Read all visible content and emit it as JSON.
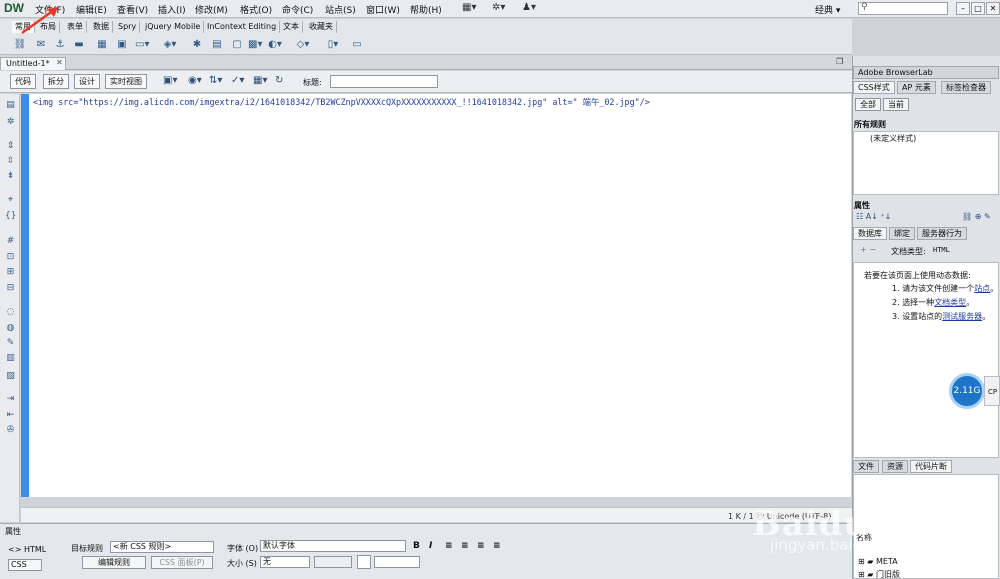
{
  "app": {
    "logo": "DW",
    "menu": [
      "文件(F)",
      "编辑(E)",
      "查看(V)",
      "插入(I)",
      "修改(M)",
      "格式(O)",
      "命令(C)",
      "站点(S)",
      "窗口(W)",
      "帮助(H)"
    ],
    "workspace": "经典",
    "search_placeholder": ""
  },
  "insert_tabs": [
    "常用",
    "布局",
    "表单",
    "数据",
    "Spry",
    "jQuery Mobile",
    "InContext Editing",
    "文本",
    "收藏夹"
  ],
  "document": {
    "tab_label": "Untitled-1*",
    "views": [
      "代码",
      "拆分",
      "设计",
      "实时视图"
    ],
    "title_label": "标题:",
    "title_value": "",
    "code": "<img src=\"https://img.alicdn.com/imgextra/i2/1641018342/TB2WCZnpVXXXXcQXpXXXXXXXXXXX_!!1641018342.jpg\" alt=\" 端午_02.jpg\"/>",
    "status": "1 K / 1 秒  Unicode (UTF-8)"
  },
  "properties": {
    "title": "属性",
    "html_btn": "<> HTML",
    "css_btn": "CSS",
    "target_rule_label": "目标规则",
    "target_rule_value": "<新 CSS 规则>",
    "edit_rule_btn": "编辑规则",
    "css_panel_btn": "CSS 面板(P)",
    "font_label": "字体 (O)",
    "font_value": "默认字体",
    "size_label": "大小 (S)",
    "size_value": "无"
  },
  "right_panel": {
    "browserlab": "Adobe BrowserLab",
    "css_tabs": [
      "CSS样式",
      "AP 元素",
      "标签检查器"
    ],
    "css_buttons": [
      "全部",
      "当前"
    ],
    "all_rules": "所有规则",
    "undefined_style": "(未定义样式)",
    "props_title": "属性",
    "db_tabs": [
      "数据库",
      "绑定",
      "服务器行为"
    ],
    "doc_type_label": "文档类型:",
    "doc_type_value": "HTML",
    "dynamic_intro": "若要在该页面上使用动态数据:",
    "steps": [
      {
        "num": "1.",
        "pre": "请为该文件创建一个",
        "link": "站点",
        "post": "。"
      },
      {
        "num": "2.",
        "pre": "选择一种",
        "link": "文档类型",
        "post": "。"
      },
      {
        "num": "3.",
        "pre": "设置站点的",
        "link": "测试服务器",
        "post": "。"
      }
    ],
    "file_tabs": [
      "文件",
      "资源",
      "代码片断"
    ],
    "name_header": "名称",
    "snippets": [
      "META",
      "门旧版"
    ],
    "bubble": "2.11G",
    "bubble_side": "CP"
  },
  "watermark": {
    "main": "Baidu经验",
    "sub": "jingyan.baidu.com"
  }
}
